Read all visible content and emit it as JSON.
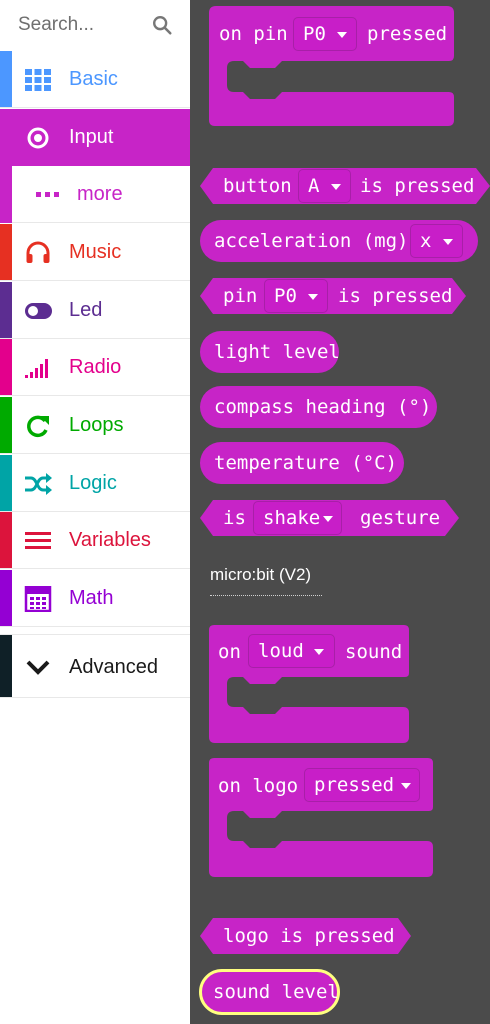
{
  "search": {
    "placeholder": "Search..."
  },
  "sidebar": {
    "items": [
      {
        "label": "Basic",
        "color": "#4c97ff"
      },
      {
        "label": "Input",
        "color": "#c724c7"
      },
      {
        "label": "more",
        "color": "#c724c7"
      },
      {
        "label": "Music",
        "color": "#e63022"
      },
      {
        "label": "Led",
        "color": "#5c2d91"
      },
      {
        "label": "Radio",
        "color": "#e3008c"
      },
      {
        "label": "Loops",
        "color": "#00aa00"
      },
      {
        "label": "Logic",
        "color": "#00a4a6"
      },
      {
        "label": "Variables",
        "color": "#dc143c"
      },
      {
        "label": "Math",
        "color": "#9400d3"
      },
      {
        "label": "Advanced",
        "color": "#0f2027"
      }
    ],
    "selected": "Input"
  },
  "workspace": {
    "block_color": "#c724c7",
    "blocks": {
      "on_pin": {
        "prefix": "on pin",
        "dropdown": "P0",
        "suffix": "pressed"
      },
      "button": {
        "prefix": "button",
        "dropdown": "A",
        "suffix": "is pressed"
      },
      "acceleration": {
        "prefix": "acceleration (mg)",
        "dropdown": "x"
      },
      "pin": {
        "prefix": "pin",
        "dropdown": "P0",
        "suffix": "is pressed"
      },
      "light_level": {
        "label": "light level"
      },
      "compass": {
        "label": "compass heading (°)"
      },
      "temperature": {
        "label": "temperature (°C)"
      },
      "is_gesture": {
        "prefix": "is",
        "dropdown": "shake",
        "suffix": "gesture"
      },
      "on_loud": {
        "prefix": "on",
        "dropdown": "loud",
        "suffix": "sound"
      },
      "on_logo": {
        "prefix": "on logo",
        "dropdown": "pressed"
      },
      "logo_pressed": {
        "label": "logo is pressed"
      },
      "sound_level": {
        "label": "sound level",
        "highlight": "#ffff80"
      }
    },
    "section_label": "micro:bit (V2)"
  }
}
